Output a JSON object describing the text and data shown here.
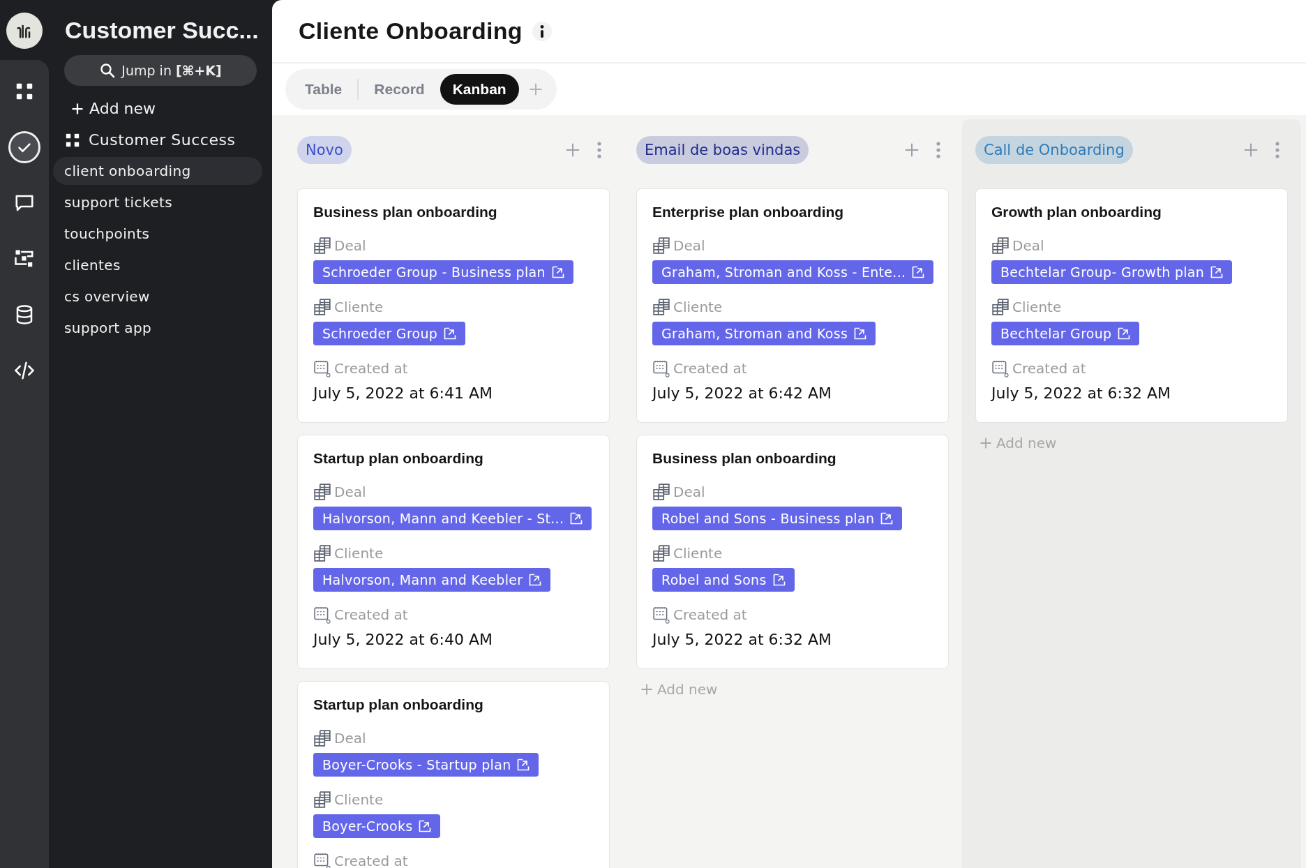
{
  "rail": [
    {
      "kind": "apps",
      "selected": false
    },
    {
      "kind": "check",
      "selected": true
    },
    {
      "kind": "chat",
      "selected": false
    },
    {
      "kind": "flow",
      "selected": false
    },
    {
      "kind": "database",
      "selected": false
    },
    {
      "kind": "code",
      "selected": false
    }
  ],
  "sidebar": {
    "title": "Customer Succ...",
    "search": "Jump in **[⌘+K]**",
    "add_new": "Add new",
    "section": "Customer Success",
    "items": [
      {
        "label": "client onboarding",
        "selected": true
      },
      {
        "label": "support tickets",
        "selected": false
      },
      {
        "label": "touchpoints",
        "selected": false
      },
      {
        "label": "clientes",
        "selected": false
      },
      {
        "label": "cs overview",
        "selected": false
      },
      {
        "label": "support app",
        "selected": false
      }
    ]
  },
  "header": {
    "title": "Cliente Onboarding"
  },
  "views": [
    {
      "label": "Table",
      "selected": false
    },
    {
      "label": "Record",
      "selected": false
    },
    {
      "label": "Kanban",
      "selected": true
    }
  ],
  "columns": [
    {
      "title": "Novo",
      "color": "#3a4fcf",
      "highlighted": false,
      "cards": [
        {
          "title": "Business plan onboarding",
          "fields": [
            {
              "kind": "link",
              "label": "Deal",
              "value": "Schroeder Group - Business plan"
            },
            {
              "kind": "link",
              "label": "Cliente",
              "value": "Schroeder Group"
            },
            {
              "kind": "date",
              "label": "Created at",
              "value": "July 5, 2022 at 6:41 AM"
            }
          ]
        },
        {
          "title": "Startup plan onboarding",
          "fields": [
            {
              "kind": "link",
              "label": "Deal",
              "value": "Halvorson, Mann and Keebler - St..."
            },
            {
              "kind": "link",
              "label": "Cliente",
              "value": "Halvorson, Mann and Keebler"
            },
            {
              "kind": "date",
              "label": "Created at",
              "value": "July 5, 2022 at 6:40 AM"
            }
          ]
        },
        {
          "title": "Startup plan onboarding",
          "fields": [
            {
              "kind": "link",
              "label": "Deal",
              "value": "Boyer-Crooks - Startup plan"
            },
            {
              "kind": "link",
              "label": "Cliente",
              "value": "Boyer-Crooks"
            },
            {
              "kind": "date",
              "label": "Created at"
            }
          ]
        }
      ]
    },
    {
      "title": "Email de boas vindas",
      "color": "#1f2b8c",
      "highlighted": false,
      "add_new": "Add new",
      "cards": [
        {
          "title": "Enterprise plan onboarding",
          "fields": [
            {
              "kind": "link",
              "label": "Deal",
              "value": "Graham, Stroman and Koss - Ente..."
            },
            {
              "kind": "link",
              "label": "Cliente",
              "value": "Graham, Stroman and Koss"
            },
            {
              "kind": "date",
              "label": "Created at",
              "value": "July 5, 2022 at 6:42 AM"
            }
          ]
        },
        {
          "title": "Business plan onboarding",
          "fields": [
            {
              "kind": "link",
              "label": "Deal",
              "value": "Robel and Sons - Business plan"
            },
            {
              "kind": "link",
              "label": "Cliente",
              "value": "Robel and Sons"
            },
            {
              "kind": "date",
              "label": "Created at",
              "value": "July 5, 2022 at 6:32 AM"
            }
          ]
        }
      ]
    },
    {
      "title": "Call de Onboarding",
      "color": "#2f7bb8",
      "highlighted": true,
      "add_new": "Add new",
      "cards": [
        {
          "title": "Growth plan onboarding",
          "fields": [
            {
              "kind": "link",
              "label": "Deal",
              "value": "Bechtelar Group- Growth plan"
            },
            {
              "kind": "link",
              "label": "Cliente",
              "value": "Bechtelar Group"
            },
            {
              "kind": "date",
              "label": "Created at",
              "value": "July 5, 2022 at 6:32 AM"
            }
          ]
        }
      ]
    }
  ]
}
